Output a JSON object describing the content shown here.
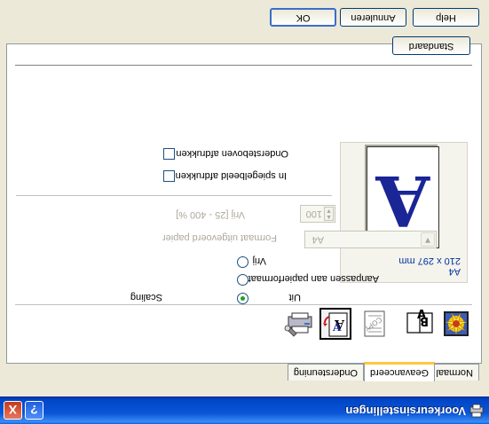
{
  "window": {
    "title": "Voorkeursinstellingen",
    "help_glyph": "?",
    "close_glyph": "X"
  },
  "tabs": [
    {
      "label": "Normaal",
      "selected": false
    },
    {
      "label": "Geavanceerd",
      "selected": true
    },
    {
      "label": "Ondersteuning",
      "selected": false
    }
  ],
  "toolbar": {
    "icons": [
      "print-quality-icon",
      "duplex-booklet-icon",
      "watermark-icon",
      "page-setting-icon",
      "device-options-icon"
    ],
    "selected": "page-setting-icon"
  },
  "preview": {
    "size_line1": "A4",
    "size_line2": "210 x 297 mm",
    "glyph": "A"
  },
  "scaling": {
    "label": "Scaling",
    "options": [
      "Uit",
      "Aanpassen aan papierformaat",
      "Vrij"
    ],
    "selected": "Uit",
    "paper_format_label": "Formaat uitgevoerd papier",
    "paper_format_value": "A4",
    "free_label": "Vrij [25 - 400 %]",
    "free_value": "100"
  },
  "checkboxes": {
    "mirror": {
      "label": "In spiegelbeeld afdrukken",
      "checked": false
    },
    "upside_down": {
      "label": "Ondersteboven afdrukken",
      "checked": false
    }
  },
  "buttons": {
    "default": "Standaard",
    "ok": "OK",
    "cancel": "Annuleren",
    "help": "Help"
  },
  "colors": {
    "titlebar": "#0a56d6",
    "preview_glyph": "#1a2596",
    "radio_dot": "#21a121"
  }
}
